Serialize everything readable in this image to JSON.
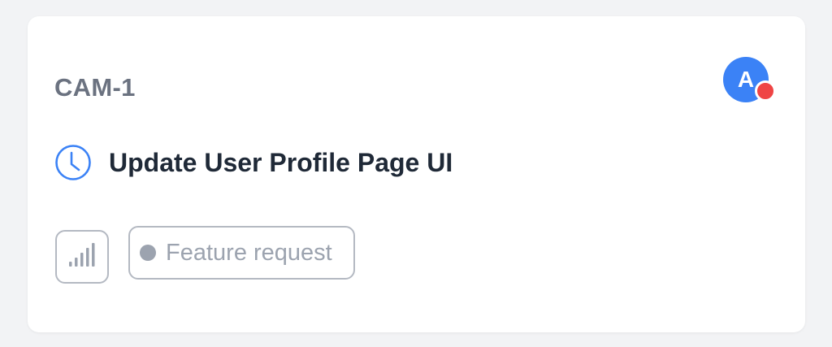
{
  "card": {
    "issue_id": "CAM-1",
    "title": "Update User Profile Page UI",
    "status_icon": "clock-icon",
    "assignee": {
      "initial": "A",
      "avatar_color": "#3b82f6",
      "status_color": "#ef4444"
    },
    "priority": {
      "icon": "signal-bars-icon"
    },
    "label": {
      "text": "Feature request",
      "dot_color": "#9ca3af"
    }
  },
  "colors": {
    "background": "#f2f3f5",
    "card": "#ffffff",
    "title_text": "#1f2937",
    "id_text": "#6b7280",
    "accent_blue": "#3b82f6",
    "border": "#b4b9c2"
  }
}
